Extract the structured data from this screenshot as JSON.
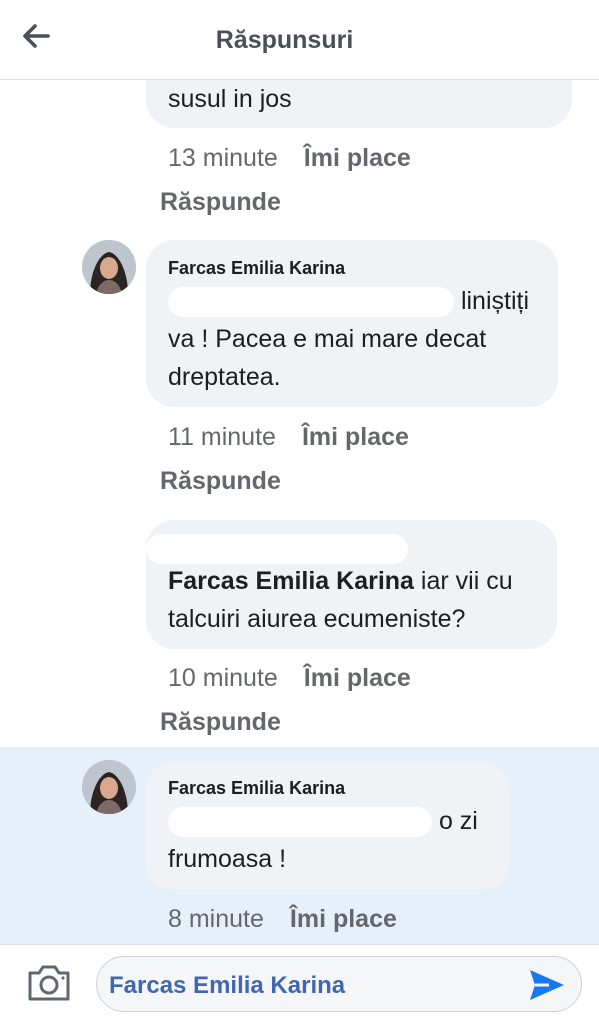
{
  "header": {
    "title": "Răspunsuri",
    "back_icon": "arrow-left-icon"
  },
  "comments": [
    {
      "text": "susul in jos",
      "time": "13 minute",
      "like_label": "Îmi place",
      "reply_label": "Răspunde"
    },
    {
      "author": "Farcas Emilia Karina",
      "text_line1_end": "liniștiți",
      "text_line2": "va ! Pacea e mai mare decat",
      "text_line3": "dreptatea.",
      "time": "11 minute",
      "like_label": "Îmi place",
      "reply_label": "Răspunde"
    },
    {
      "mention": "Farcas Emilia Karina",
      "text_line1_rest": " iar vii cu",
      "text_line2": "talcuiri aiurea ecumeniste?",
      "time": "10 minute",
      "like_label": "Îmi place",
      "reply_label": "Răspunde"
    },
    {
      "author": "Farcas Emilia Karina",
      "text_line1_end": "o zi",
      "text_line2": "frumoasa !",
      "time": "8 minute",
      "like_label": "Îmi place"
    }
  ],
  "composer": {
    "text": "Farcas Emilia Karina",
    "camera_icon": "camera-icon",
    "send_icon": "send-icon"
  },
  "colors": {
    "bubble": "#f0f2f5",
    "highlight": "#e6f0fb",
    "meta": "#65676b",
    "accent": "#1877f2"
  }
}
